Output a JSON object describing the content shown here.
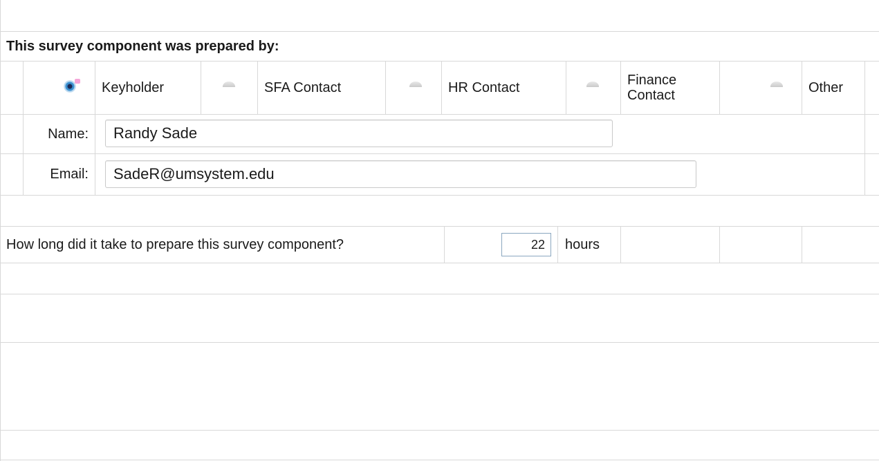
{
  "header": {
    "title": "This survey component was prepared by:"
  },
  "roles": [
    {
      "label": "Keyholder",
      "selected": true
    },
    {
      "label": "SFA Contact",
      "selected": false
    },
    {
      "label": "HR Contact",
      "selected": false
    },
    {
      "label": "Finance Contact",
      "selected": false
    },
    {
      "label": "Other",
      "selected": false
    }
  ],
  "name": {
    "label": "Name:",
    "value": "Randy Sade"
  },
  "email": {
    "label": "Email:",
    "value": "SadeR@umsystem.edu"
  },
  "time": {
    "question": "How long did it take to prepare this survey component?",
    "value": "22",
    "unit": "hours"
  }
}
